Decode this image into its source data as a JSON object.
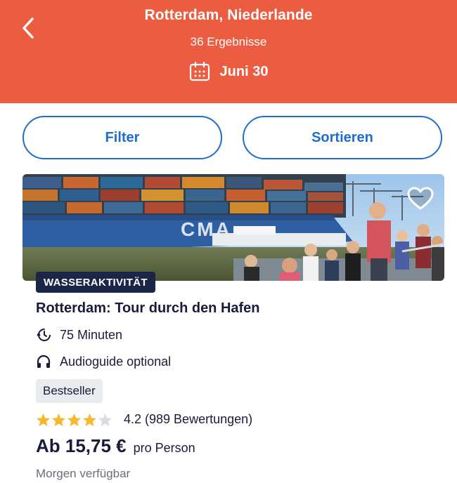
{
  "header": {
    "title": "Rotterdam, Niederlande",
    "results": "36 Ergebnisse",
    "date": "Juni 30",
    "back_icon": "chevron-left-icon",
    "calendar_icon": "calendar-icon",
    "background": "#EB5C40"
  },
  "buttons": {
    "filter": "Filter",
    "sort": "Sortieren",
    "accent": "#1C6DD0"
  },
  "card": {
    "category": "WASSERAKTIVITÄT",
    "title": "Rotterdam: Tour durch den Hafen",
    "duration": "75 Minuten",
    "duration_icon": "clock-history-icon",
    "audio": "Audioguide optional",
    "audio_icon": "headphones-icon",
    "badge": "Bestseller",
    "rating_value": 4.2,
    "rating_text": "4.2 (989 Bewertungen)",
    "stars_filled": 4,
    "stars_total": 5,
    "price": "Ab 15,75 €",
    "price_unit": "pro Person",
    "availability": "Morgen verfügbar",
    "ship_text": "CMA",
    "favorite_icon": "heart-outline-icon"
  }
}
